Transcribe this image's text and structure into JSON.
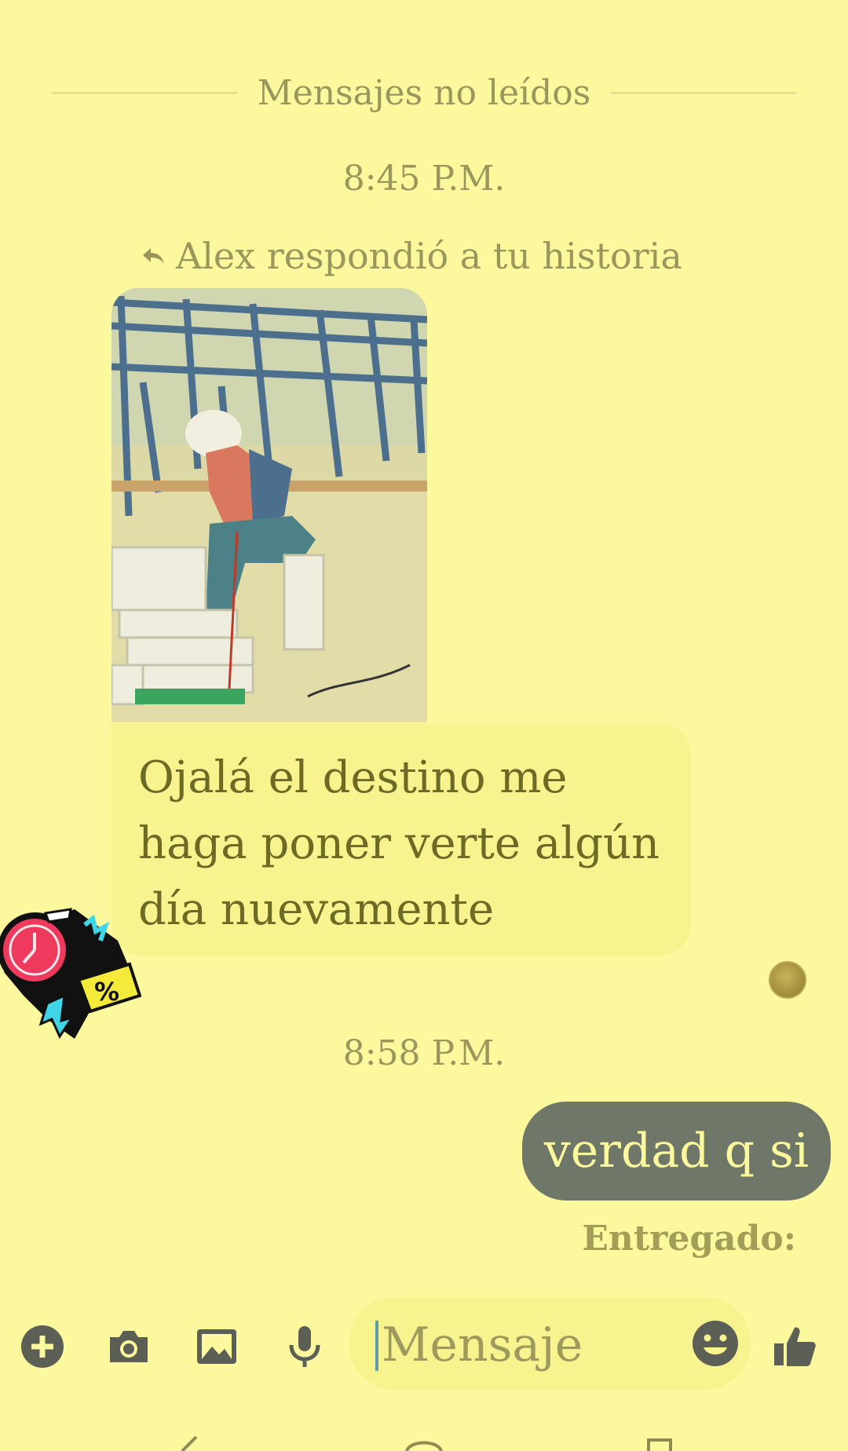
{
  "unread_divider": {
    "label": "Mensajes no leídos"
  },
  "messages": {
    "time_1": "8:45 P.M.",
    "story_reply_note": "Alex respondió a tu historia",
    "incoming_text": "Ojalá el destino me haga poner verte algún día nuevamente",
    "time_2": "8:58 P.M.",
    "outgoing_text": "verdad q si",
    "status": "Entregado:"
  },
  "composer": {
    "placeholder": "Mensaje"
  },
  "toolbar": {
    "icons": [
      "plus-icon",
      "camera-icon",
      "gallery-icon",
      "microphone-icon",
      "emoji-icon",
      "thumbs-up-icon"
    ]
  },
  "colors": {
    "background": "#fbf89e",
    "incoming_bubble": "#f7f48f",
    "outgoing_bubble": "#6f7768",
    "icon": "#5b5f55"
  }
}
